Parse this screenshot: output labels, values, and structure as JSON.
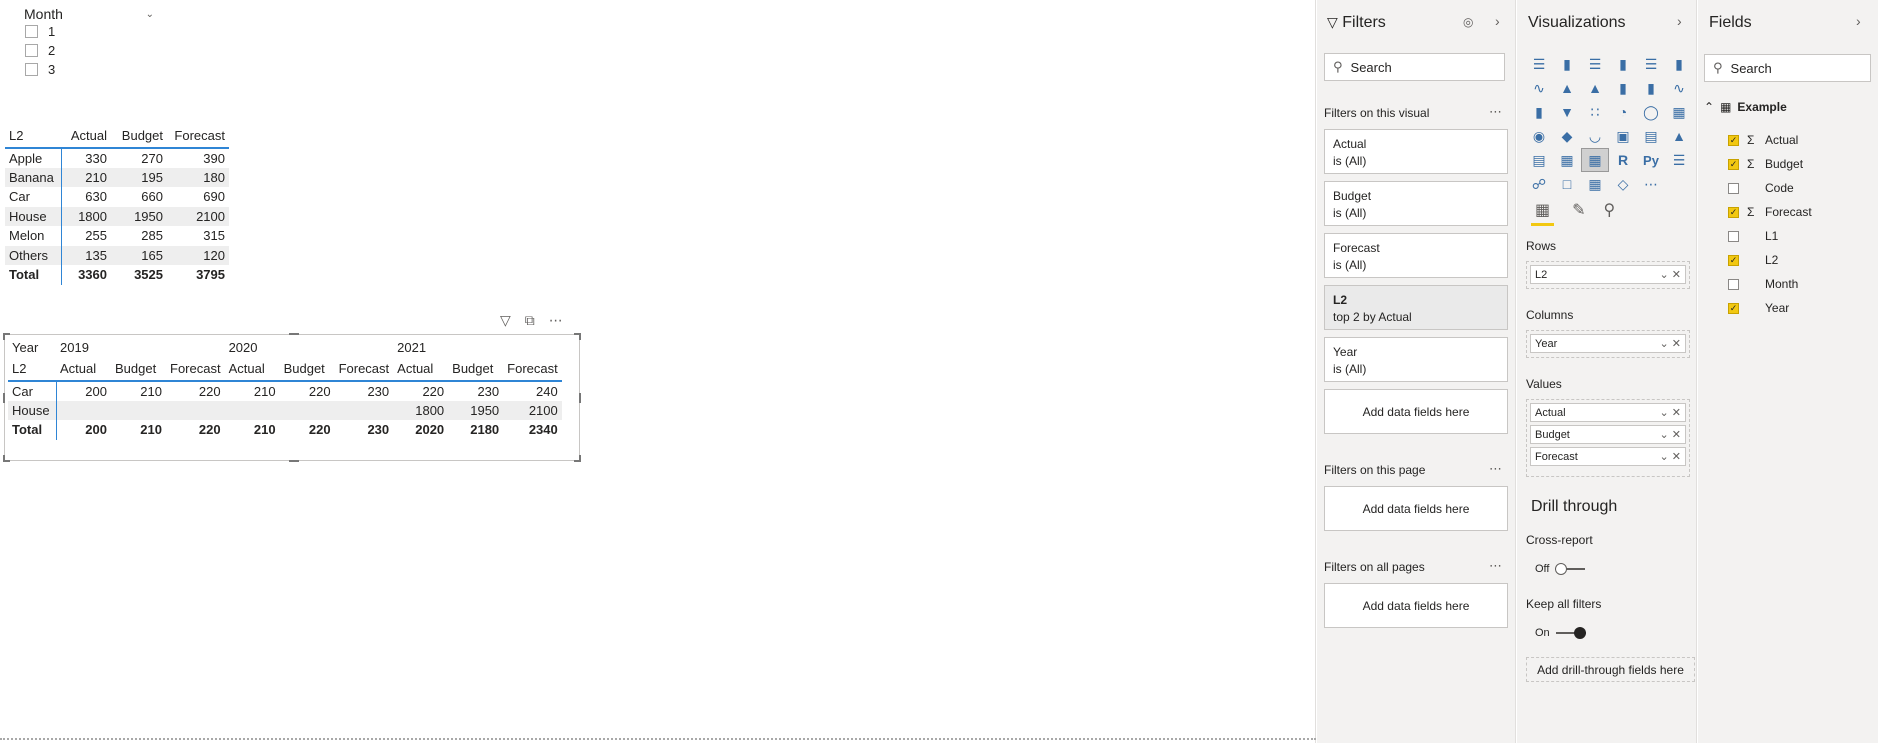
{
  "slicer": {
    "title": "Month",
    "options": [
      "1",
      "2",
      "3"
    ]
  },
  "matrix1": {
    "headers": [
      "L2",
      "Actual",
      "Budget",
      "Forecast"
    ],
    "rows": [
      [
        "Apple",
        "330",
        "270",
        "390"
      ],
      [
        "Banana",
        "210",
        "195",
        "180"
      ],
      [
        "Car",
        "630",
        "660",
        "690"
      ],
      [
        "House",
        "1800",
        "1950",
        "2100"
      ],
      [
        "Melon",
        "255",
        "285",
        "315"
      ],
      [
        "Others",
        "135",
        "165",
        "120"
      ]
    ],
    "total": [
      "Total",
      "3360",
      "3525",
      "3795"
    ]
  },
  "matrix2": {
    "year_label": "Year",
    "years": [
      "2019",
      "2020",
      "2021"
    ],
    "row_label": "L2",
    "measures": [
      "Actual",
      "Budget",
      "Forecast",
      "Actual",
      "Budget",
      "Forecast",
      "Actual",
      "Budget",
      "Forecast"
    ],
    "rows": [
      [
        "Car",
        "200",
        "210",
        "220",
        "210",
        "220",
        "230",
        "220",
        "230",
        "240"
      ],
      [
        "House",
        "",
        "",
        "",
        "",
        "",
        "",
        "1800",
        "1950",
        "2100"
      ]
    ],
    "total": [
      "Total",
      "200",
      "210",
      "220",
      "210",
      "220",
      "230",
      "2020",
      "2180",
      "2340"
    ]
  },
  "filters": {
    "title": "Filters",
    "search_placeholder": "Search",
    "visual_section": "Filters on this visual",
    "cards": [
      {
        "name": "Actual",
        "state": "is (All)"
      },
      {
        "name": "Budget",
        "state": "is (All)"
      },
      {
        "name": "Forecast",
        "state": "is (All)"
      },
      {
        "name": "L2",
        "state": "top 2 by Actual"
      },
      {
        "name": "Year",
        "state": "is (All)"
      }
    ],
    "add_label": "Add data fields here",
    "page_section": "Filters on this page",
    "all_section": "Filters on all pages"
  },
  "visualizations": {
    "title": "Visualizations",
    "rows_label": "Rows",
    "rows_field": "L2",
    "columns_label": "Columns",
    "columns_field": "Year",
    "values_label": "Values",
    "values_fields": [
      "Actual",
      "Budget",
      "Forecast"
    ],
    "drill_title": "Drill through",
    "cross_report_label": "Cross-report",
    "cross_report_state": "Off",
    "keep_filters_label": "Keep all filters",
    "keep_filters_state": "On",
    "add_drill_label": "Add drill-through fields here",
    "r_icon": "R",
    "py_icon": "Py"
  },
  "fields": {
    "title": "Fields",
    "search_placeholder": "Search",
    "table_name": "Example",
    "items": [
      {
        "name": "Actual",
        "checked": true,
        "sigma": true
      },
      {
        "name": "Budget",
        "checked": true,
        "sigma": true
      },
      {
        "name": "Code",
        "checked": false,
        "sigma": false
      },
      {
        "name": "Forecast",
        "checked": true,
        "sigma": true
      },
      {
        "name": "L1",
        "checked": false,
        "sigma": false
      },
      {
        "name": "L2",
        "checked": true,
        "sigma": false
      },
      {
        "name": "Month",
        "checked": false,
        "sigma": false
      },
      {
        "name": "Year",
        "checked": true,
        "sigma": false
      }
    ]
  },
  "colors": {
    "accent_yellow": "#f2c811",
    "table_rule": "#2f85d5",
    "pane_bg": "#f3f2f1"
  }
}
